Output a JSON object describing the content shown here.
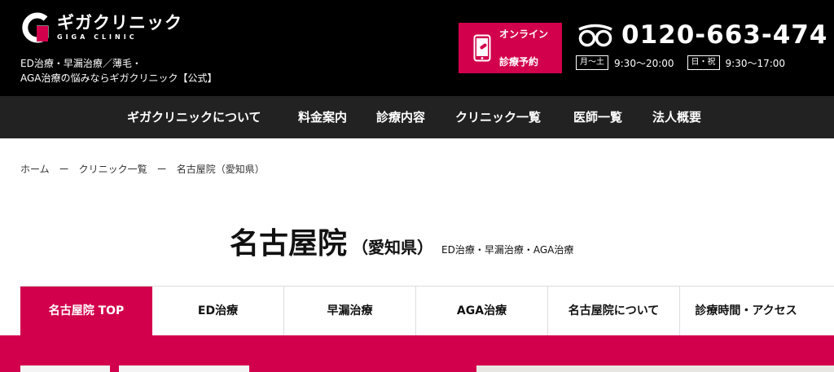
{
  "header": {
    "logo_jp": "ギガクリニック",
    "logo_en": "GIGA CLINIC",
    "tagline_line1": "ED治療・早漏治療／薄毛・",
    "tagline_line2": "AGA治療の悩みならギガクリニック【公式】",
    "online_button_line1": "オンライン",
    "online_button_line2": "診療予約",
    "phone_number": "0120-663-474",
    "hours": [
      {
        "days": "月〜土",
        "time": "9:30〜20:00"
      },
      {
        "days": "日・祝",
        "time": "9:30〜17:00"
      }
    ],
    "brand_color": "#d2004c"
  },
  "nav": {
    "items": [
      "ギガクリニックについて",
      "料金案内",
      "診療内容",
      "クリニック一覧",
      "医師一覧",
      "法人概要"
    ]
  },
  "breadcrumb": {
    "home": "ホーム",
    "separator": "ー",
    "clinics": "クリニック一覧",
    "current": "名古屋院（愛知県）"
  },
  "page": {
    "title": "名古屋院",
    "prefecture": "（愛知県）",
    "subtitle": "ED治療・早漏治療・AGA治療"
  },
  "tabs": {
    "items": [
      "名古屋院 TOP",
      "ED治療",
      "早漏治療",
      "AGA治療",
      "名古屋院について",
      "診療時間・アクセス"
    ],
    "active_index": 0
  }
}
